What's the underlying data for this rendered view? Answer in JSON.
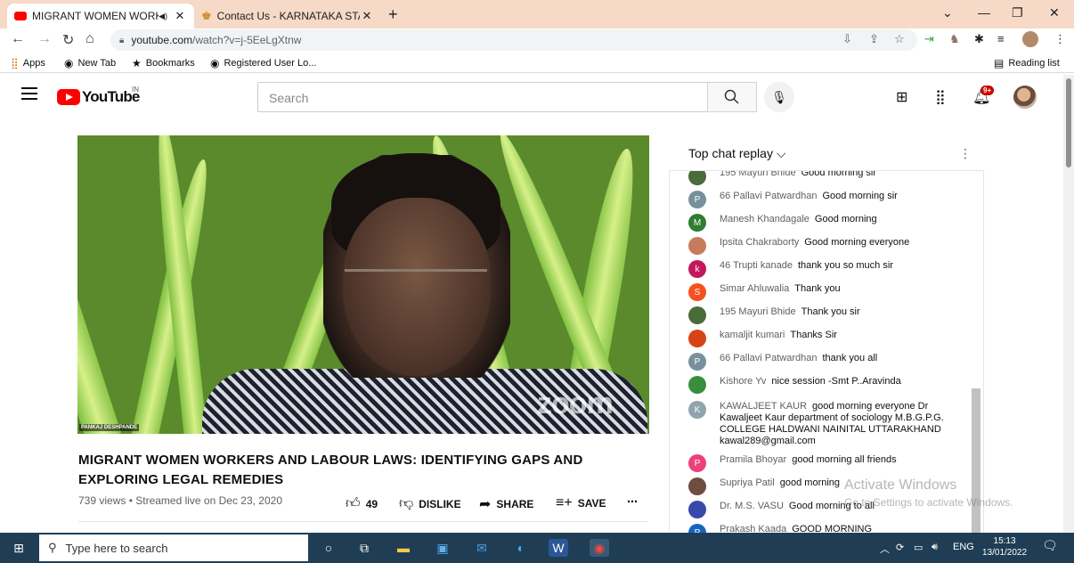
{
  "browser": {
    "tabs": [
      {
        "title": "MIGRANT WOMEN WORKER",
        "active": true
      },
      {
        "title": "Contact Us - KARNATAKA STATE",
        "active": false
      }
    ],
    "url_host": "youtube.com",
    "url_path": "/watch?v=j-5EeLgXtnw",
    "bookmarks": [
      {
        "icon": "apps-grid-icon",
        "label": "Apps"
      },
      {
        "icon": "globe-icon",
        "label": "New Tab"
      },
      {
        "icon": "star-icon",
        "label": "Bookmarks"
      },
      {
        "icon": "globe-icon",
        "label": "Registered User Lo..."
      }
    ],
    "reading_list": "Reading list"
  },
  "youtube": {
    "logo": "YouTube",
    "region": "IN",
    "search_placeholder": "Search",
    "notification_count": "9+"
  },
  "video": {
    "speaker_tag": "PANKAJ DESHPANDE",
    "watermark": "zoom",
    "title": "MIGRANT WOMEN WORKERS AND LABOUR LAWS: IDENTIFYING GAPS AND EXPLORING LEGAL REMEDIES",
    "meta": "739 views • Streamed live on Dec 23, 2020",
    "likes": "49",
    "dislike_label": "DISLIKE",
    "share_label": "SHARE",
    "save_label": "SAVE"
  },
  "chat": {
    "header": "Top chat replay",
    "messages": [
      {
        "avatar": "",
        "avatar_color": "#4a6b3a",
        "author": "195 Mayuri Bhide",
        "text": "Good morning sir"
      },
      {
        "avatar": "P",
        "avatar_color": "#78909c",
        "author": "66 Pallavi Patwardhan",
        "text": "Good morning sir"
      },
      {
        "avatar": "M",
        "avatar_color": "#2e7d32",
        "author": "Manesh Khandagale",
        "text": "Good morning"
      },
      {
        "avatar": "",
        "avatar_color": "#c67b5c",
        "author": "Ipsita Chakraborty",
        "text": "Good morning everyone"
      },
      {
        "avatar": "k",
        "avatar_color": "#c2185b",
        "author": "46 Trupti kanade",
        "text": "thank you so much sir"
      },
      {
        "avatar": "S",
        "avatar_color": "#f4511e",
        "author": "Simar Ahluwalia",
        "text": "Thank you"
      },
      {
        "avatar": "",
        "avatar_color": "#4a6b3a",
        "author": "195 Mayuri Bhide",
        "text": "Thank you sir"
      },
      {
        "avatar": "",
        "avatar_color": "#d84315",
        "author": "kamaljit kumari",
        "text": "Thanks Sir"
      },
      {
        "avatar": "P",
        "avatar_color": "#78909c",
        "author": "66 Pallavi Patwardhan",
        "text": "thank you all"
      },
      {
        "avatar": "",
        "avatar_color": "#388e3c",
        "author": "Kishore Yv",
        "text": "nice session -Smt P..Aravinda"
      },
      {
        "avatar": "K",
        "avatar_color": "#90a4ae",
        "author": "KAWALJEET KAUR",
        "text": "good morning everyone Dr Kawaljeet Kaur department of sociology M.B.G.P.G. COLLEGE HALDWANI NAINITAL UTTARAKHAND kawal289@gmail.com"
      },
      {
        "avatar": "P",
        "avatar_color": "#ec407a",
        "author": "Pramila Bhoyar",
        "text": "good morning all friends"
      },
      {
        "avatar": "",
        "avatar_color": "#6d4c41",
        "author": "Supriya Patil",
        "text": "good morning"
      },
      {
        "avatar": "",
        "avatar_color": "#3949ab",
        "author": "Dr. M.S. VASU",
        "text": "Good morning to all"
      },
      {
        "avatar": "P",
        "avatar_color": "#1565c0",
        "author": "Prakash Kaada",
        "text": "GOOD MORNING"
      }
    ]
  },
  "windows_watermark": {
    "line1": "Activate Windows",
    "line2": "Go to Settings to activate Windows."
  },
  "taskbar": {
    "search_placeholder": "Type here to search",
    "language": "ENG",
    "time": "15:13",
    "date": "13/01/2022"
  }
}
